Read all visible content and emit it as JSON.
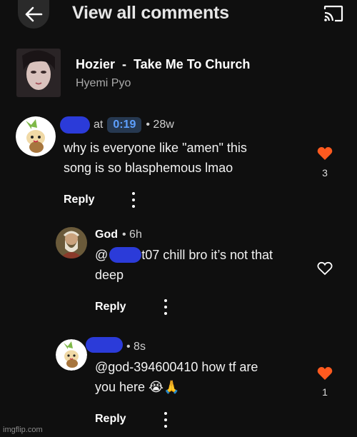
{
  "header": {
    "title": "View all comments",
    "back_icon": "arrow-left-icon",
    "cast_icon": "cast-icon"
  },
  "video": {
    "title": "Hozier  -  Take Me To Church",
    "channel": "Hyemi Pyo"
  },
  "comments": [
    {
      "author_prefix": "at",
      "timestamp_chip": "0:19",
      "age": "• 28w",
      "text_line1": "why is everyone like \"amen\" this",
      "text_line2": "song is so blasphemous lmao",
      "reply_label": "Reply",
      "like_count": "3",
      "liked": true
    },
    {
      "author": "God",
      "age": "• 6h",
      "text_line1_prefix": "@",
      "text_line1_suffix": "t07 chill bro it’s not that",
      "text_line2": "deep",
      "reply_label": "Reply",
      "liked": false
    },
    {
      "age": "• 8s",
      "text_line1": "@god-394600410 how tf are",
      "text_line2": "you here 😭🙏",
      "reply_label": "Reply",
      "like_count": "1",
      "liked": true
    }
  ],
  "watermark": "imgflip.com",
  "colors": {
    "background": "#0f0f0f",
    "like_active": "#ff5a1f",
    "timestamp_text": "#5ea0ff",
    "redaction": "#2b3bd9"
  }
}
